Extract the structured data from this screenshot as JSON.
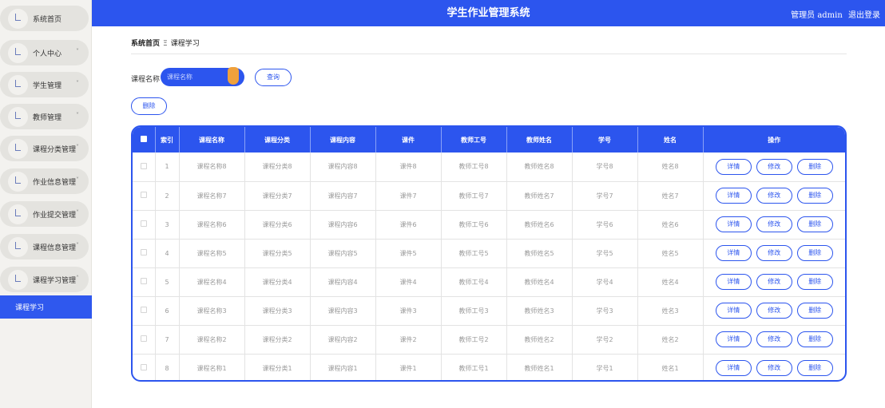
{
  "app": {
    "title": "学生作业管理系统",
    "user_label": "管理员 admin",
    "logout_label": "退出登录"
  },
  "sidebar": {
    "items": [
      {
        "label": "系统首页",
        "has_chevron": false
      },
      {
        "label": "个人中心",
        "has_chevron": true,
        "chevron": "˅"
      },
      {
        "label": "学生管理",
        "has_chevron": true,
        "chevron": "˅"
      },
      {
        "label": "教师管理",
        "has_chevron": true,
        "chevron": "˅"
      },
      {
        "label": "课程分类管理",
        "has_chevron": true,
        "chevron": "˅"
      },
      {
        "label": "作业信息管理",
        "has_chevron": true,
        "chevron": "˅"
      },
      {
        "label": "作业提交管理",
        "has_chevron": true,
        "chevron": "˅"
      },
      {
        "label": "课程信息管理",
        "has_chevron": true,
        "chevron": "˅"
      },
      {
        "label": "课程学习管理",
        "has_chevron": true,
        "chevron": "˄"
      }
    ],
    "active_sub": "课程学习"
  },
  "breadcrumb": {
    "home": "系统首页",
    "separator": "Ξ",
    "current": "课程学习"
  },
  "search": {
    "label": "课程名称",
    "placeholder": "课程名称",
    "query_button": "查询"
  },
  "toolbar": {
    "delete_button": "删除"
  },
  "table": {
    "headers": [
      "索引",
      "课程名称",
      "课程分类",
      "课程内容",
      "课件",
      "教师工号",
      "教师姓名",
      "学号",
      "姓名",
      "操作"
    ],
    "rows": [
      [
        "1",
        "课程名称8",
        "课程分类8",
        "课程内容8",
        "课件8",
        "教师工号8",
        "教师姓名8",
        "学号8",
        "姓名8"
      ],
      [
        "2",
        "课程名称7",
        "课程分类7",
        "课程内容7",
        "课件7",
        "教师工号7",
        "教师姓名7",
        "学号7",
        "姓名7"
      ],
      [
        "3",
        "课程名称6",
        "课程分类6",
        "课程内容6",
        "课件6",
        "教师工号6",
        "教师姓名6",
        "学号6",
        "姓名6"
      ],
      [
        "4",
        "课程名称5",
        "课程分类5",
        "课程内容5",
        "课件5",
        "教师工号5",
        "教师姓名5",
        "学号5",
        "姓名5"
      ],
      [
        "5",
        "课程名称4",
        "课程分类4",
        "课程内容4",
        "课件4",
        "教师工号4",
        "教师姓名4",
        "学号4",
        "姓名4"
      ],
      [
        "6",
        "课程名称3",
        "课程分类3",
        "课程内容3",
        "课件3",
        "教师工号3",
        "教师姓名3",
        "学号3",
        "姓名3"
      ],
      [
        "7",
        "课程名称2",
        "课程分类2",
        "课程内容2",
        "课件2",
        "教师工号2",
        "教师姓名2",
        "学号2",
        "姓名2"
      ],
      [
        "8",
        "课程名称1",
        "课程分类1",
        "课程内容1",
        "课件1",
        "教师工号1",
        "教师姓名1",
        "学号1",
        "姓名1"
      ]
    ],
    "row_actions": [
      "详情",
      "修改",
      "删除"
    ]
  },
  "colors": {
    "primary": "#2c55ee",
    "sidebar_bg": "#f3f2ef",
    "accent": "#f0a13c"
  }
}
